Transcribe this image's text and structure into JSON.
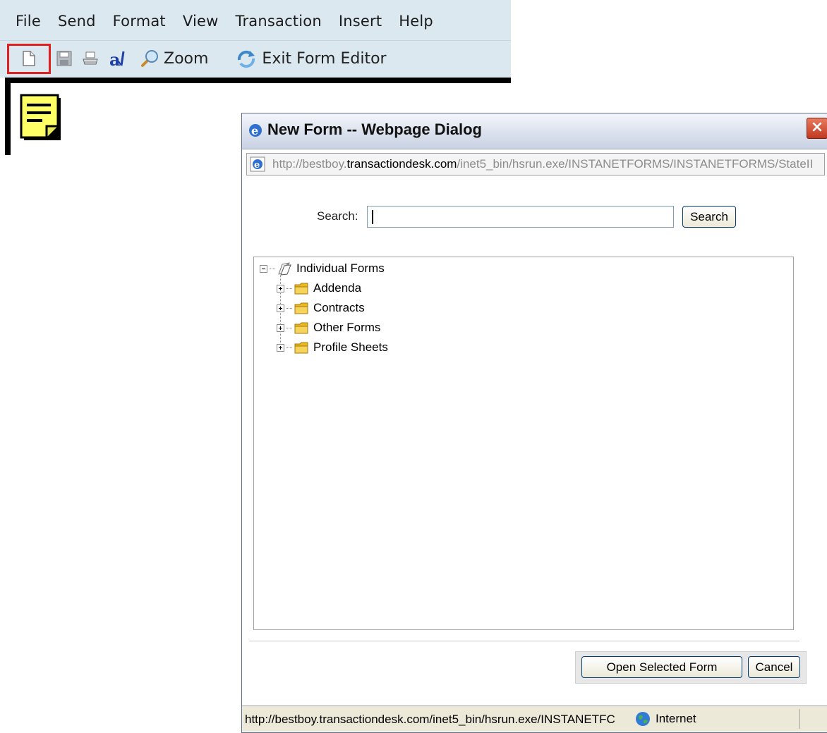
{
  "menubar": {
    "items": [
      "File",
      "Send",
      "Format",
      "View",
      "Transaction",
      "Insert",
      "Help"
    ]
  },
  "toolbar": {
    "new_icon": "new-document-icon",
    "save_icon": "save-icon",
    "print_icon": "print-icon",
    "spell_icon": "spell-check-icon",
    "zoom_label": "Zoom",
    "exit_label": "Exit Form Editor",
    "highlight_color": "#e02020"
  },
  "dialog": {
    "title": "New Form -- Webpage Dialog",
    "address": {
      "prefix": "http://bestboy.",
      "host": "transactiondesk.com",
      "path": "/inet5_bin/hsrun.exe/INSTANETFORMS/INSTANETFORMS/StateII"
    },
    "search": {
      "label": "Search:",
      "value": "",
      "button_label": "Search"
    },
    "tree": {
      "root_label": "Individual Forms",
      "items": [
        {
          "label": "Addenda"
        },
        {
          "label": "Contracts"
        },
        {
          "label": "Other Forms"
        },
        {
          "label": "Profile Sheets"
        }
      ]
    },
    "buttons": {
      "open_label": "Open Selected Form",
      "cancel_label": "Cancel"
    },
    "status": {
      "url": "http://bestboy.transactiondesk.com/inet5_bin/hsrun.exe/INSTANETFC",
      "zone": "Internet"
    }
  }
}
